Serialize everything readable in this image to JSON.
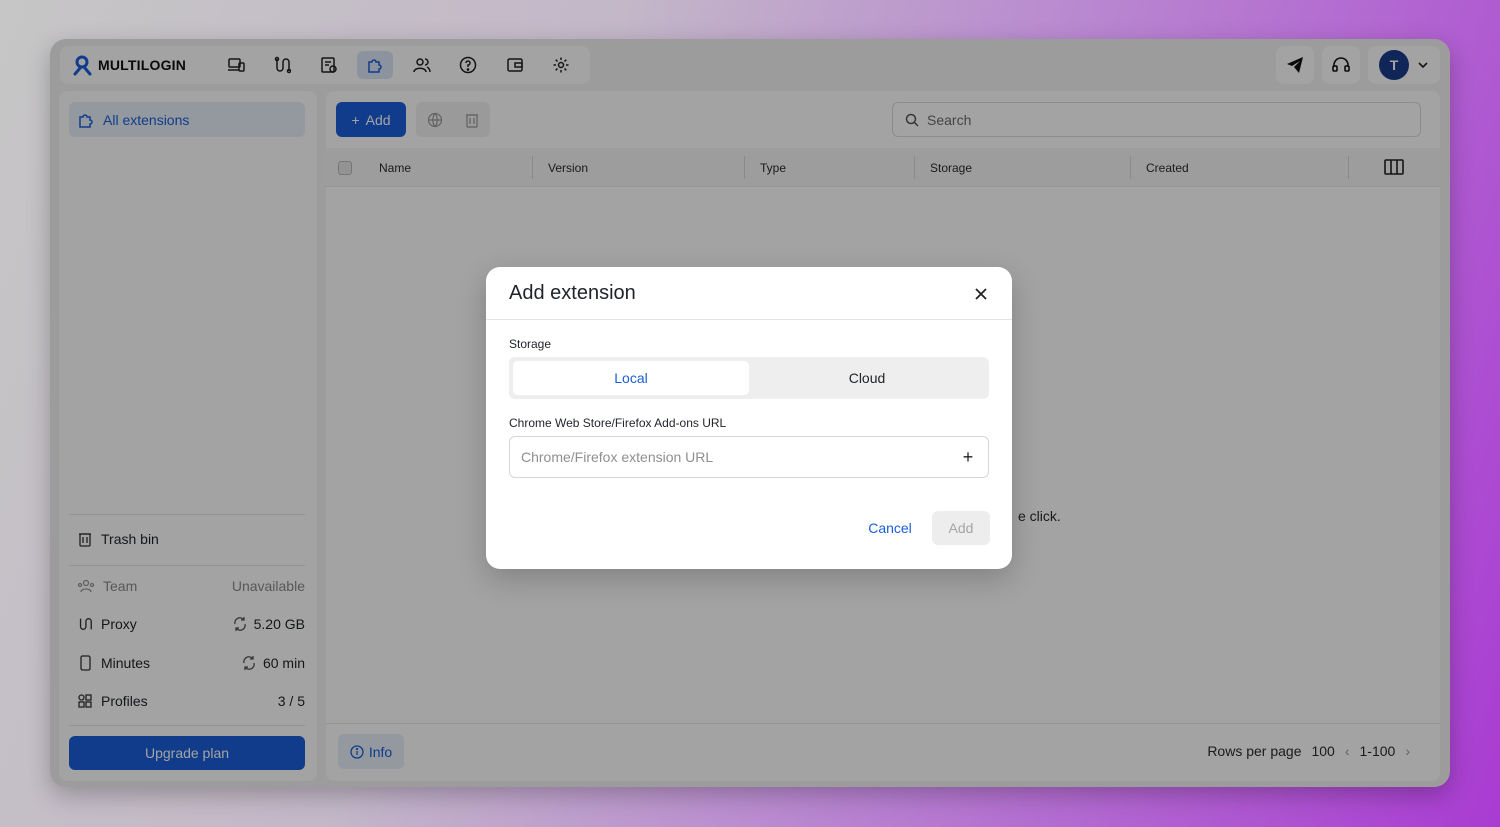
{
  "app": {
    "brand": "MULTILOGIN",
    "colors": {
      "accent": "#1b5fd9",
      "background_gradient_end": "#a93bd2"
    },
    "avatar_initial": "T"
  },
  "nav": {
    "icons": [
      "devices-icon",
      "proxy-icon",
      "profiles-icon",
      "extensions-icon",
      "team-icon",
      "help-icon",
      "wallet-icon",
      "settings-icon"
    ],
    "active": "extensions-icon"
  },
  "sidebar": {
    "active_item": "All extensions",
    "trash": "Trash bin",
    "stats": [
      {
        "label": "Team",
        "value": "Unavailable"
      },
      {
        "label": "Proxy",
        "value": "5.20 GB"
      },
      {
        "label": "Minutes",
        "value": "60 min"
      },
      {
        "label": "Profiles",
        "value": "3 / 5"
      }
    ],
    "upgrade": "Upgrade plan"
  },
  "toolbar": {
    "add_label": "Add",
    "search_placeholder": "Search"
  },
  "table": {
    "columns": [
      "Name",
      "Version",
      "Type",
      "Storage",
      "Created"
    ],
    "empty_fragment": "e click."
  },
  "footer": {
    "info": "Info",
    "rows_label": "Rows per page",
    "rows_value": "100",
    "range": "1-100"
  },
  "modal": {
    "title": "Add extension",
    "storage_label": "Storage",
    "storage_options": [
      "Local",
      "Cloud"
    ],
    "storage_selected": "Local",
    "url_label": "Chrome Web Store/Firefox Add-ons URL",
    "url_placeholder": "Chrome/Firefox extension URL",
    "url_value": "",
    "cancel": "Cancel",
    "submit": "Add"
  }
}
